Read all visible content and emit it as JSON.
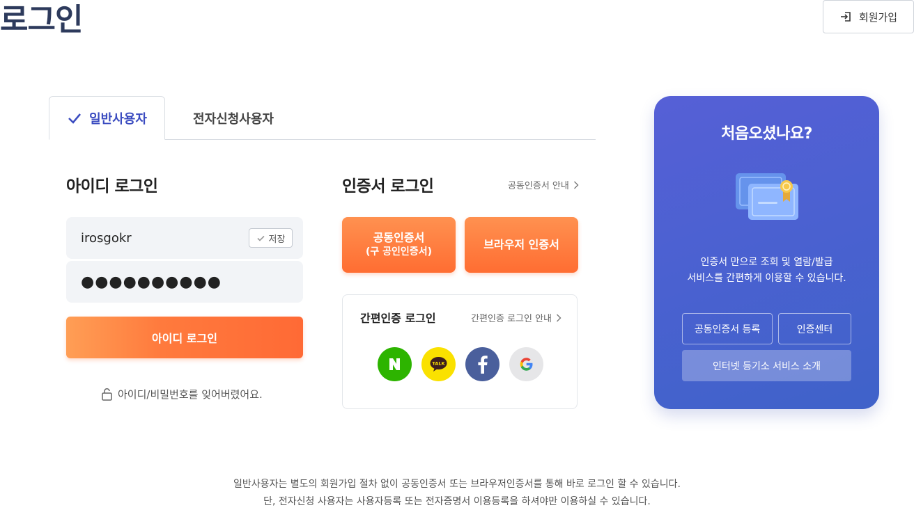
{
  "page": {
    "title": "로그인"
  },
  "header": {
    "signup_label": "회원가입"
  },
  "tabs": [
    {
      "label": "일반사용자",
      "active": true
    },
    {
      "label": "전자신청사용자",
      "active": false
    }
  ],
  "id_login": {
    "title": "아이디 로그인",
    "username_value": "irosgokr",
    "save_label": "저장",
    "password_masked": "●●●●●●●●●●",
    "login_button": "아이디 로그인",
    "forgot_label": "아이디/비밀번호를 잊어버렸어요."
  },
  "cert_login": {
    "title": "인증서 로그인",
    "guide_link": "공동인증서 안내",
    "joint_cert_button": "공동인증서",
    "joint_cert_sub": "(구 공인인증서)",
    "browser_cert_button": "브라우저 인증서"
  },
  "easy_login": {
    "title": "간편인증 로그인",
    "guide_link": "간편인증 로그인 안내",
    "providers": [
      {
        "name": "naver",
        "color": "#2db400",
        "glyph": "N"
      },
      {
        "name": "kakao",
        "color": "#fae100",
        "glyph": "TALK"
      },
      {
        "name": "facebook",
        "color": "#4a5f9c",
        "glyph": "f"
      },
      {
        "name": "google",
        "color": "#e6e6e8",
        "glyph": "G"
      }
    ]
  },
  "promo": {
    "title": "처음오셨나요?",
    "desc_line1": "인증서 만으로 조회 및 열람/발급",
    "desc_line2": "서비스를 간편하게 이용할 수 있습니다.",
    "cert_register_button": "공동인증서 등록",
    "cert_center_button": "인증센터",
    "intro_button": "인터넷 등기소  서비스 소개"
  },
  "footer": {
    "line1": "일반사용자는 별도의 회원가입 절차 없이 공동인증서 또는 브라우저인증서를 통해 바로 로그인 할 수 있습니다.",
    "line2": "단, 전자신청 사용자는 사용자등록 또는 전자증명서 이용등록을 하셔야만 이용하실 수 있습니다."
  },
  "colors": {
    "accent_blue": "#3b4cc0",
    "orange": "#ff7a3d",
    "promo_bg": "#4b61d1"
  }
}
